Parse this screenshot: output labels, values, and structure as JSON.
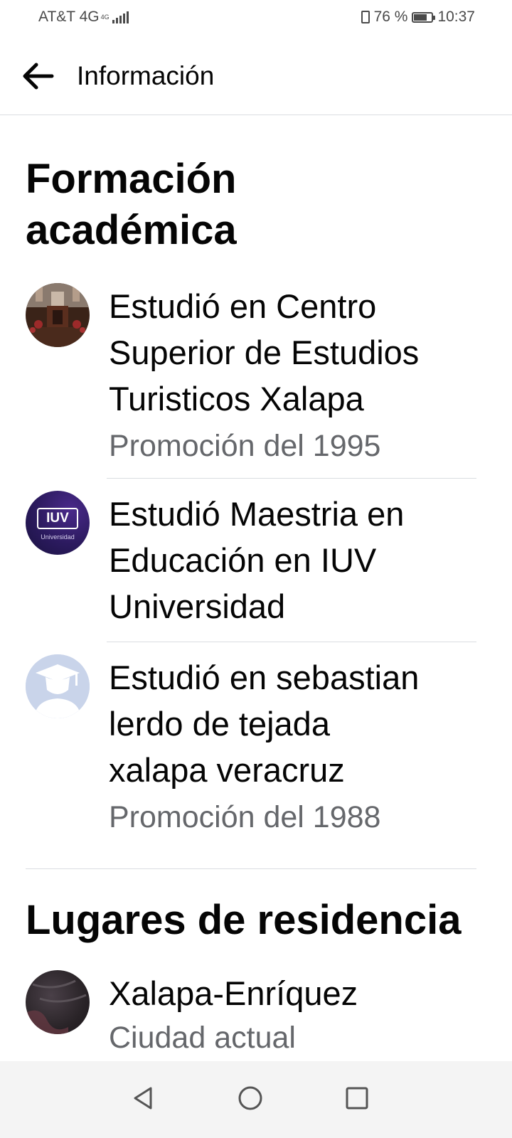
{
  "status_bar": {
    "carrier": "AT&T 4G",
    "net_badge": "4G",
    "battery_text": "76 %",
    "battery_level": 0.76,
    "time": "10:37"
  },
  "header": {
    "title": "Información",
    "back_icon": "arrow-left-icon"
  },
  "education": {
    "section_title_line1": "Formación",
    "section_title_line2": "académica",
    "items": [
      {
        "title_lines": [
          "Estudió en Centro",
          "Superior de Estudios",
          "Turisticos Xalapa"
        ],
        "subtitle": "Promoción del 1995",
        "avatar": "church-interior-photo"
      },
      {
        "title_lines": [
          "Estudió Maestria en",
          "Educación en IUV",
          "Universidad"
        ],
        "subtitle": "",
        "avatar": "iuv-logo",
        "logo_text": "IUV",
        "logo_subtext": "Universidad"
      },
      {
        "title_lines": [
          "Estudió en sebastian",
          "lerdo de tejada",
          "xalapa veracruz"
        ],
        "subtitle": "Promoción del 1988",
        "avatar": "graduate-placeholder-icon"
      }
    ]
  },
  "residence": {
    "section_title": "Lugares de residencia",
    "items": [
      {
        "title": "Xalapa-Enríquez",
        "subtitle": "Ciudad actual",
        "avatar": "city-photo"
      }
    ]
  },
  "nav": {
    "back": "nav-back-icon",
    "home": "nav-home-icon",
    "recents": "nav-recents-icon"
  },
  "colors": {
    "text_primary": "#050505",
    "text_secondary": "#65676b",
    "divider": "#dadde1",
    "iuv_brand": "#2b1a5e"
  }
}
